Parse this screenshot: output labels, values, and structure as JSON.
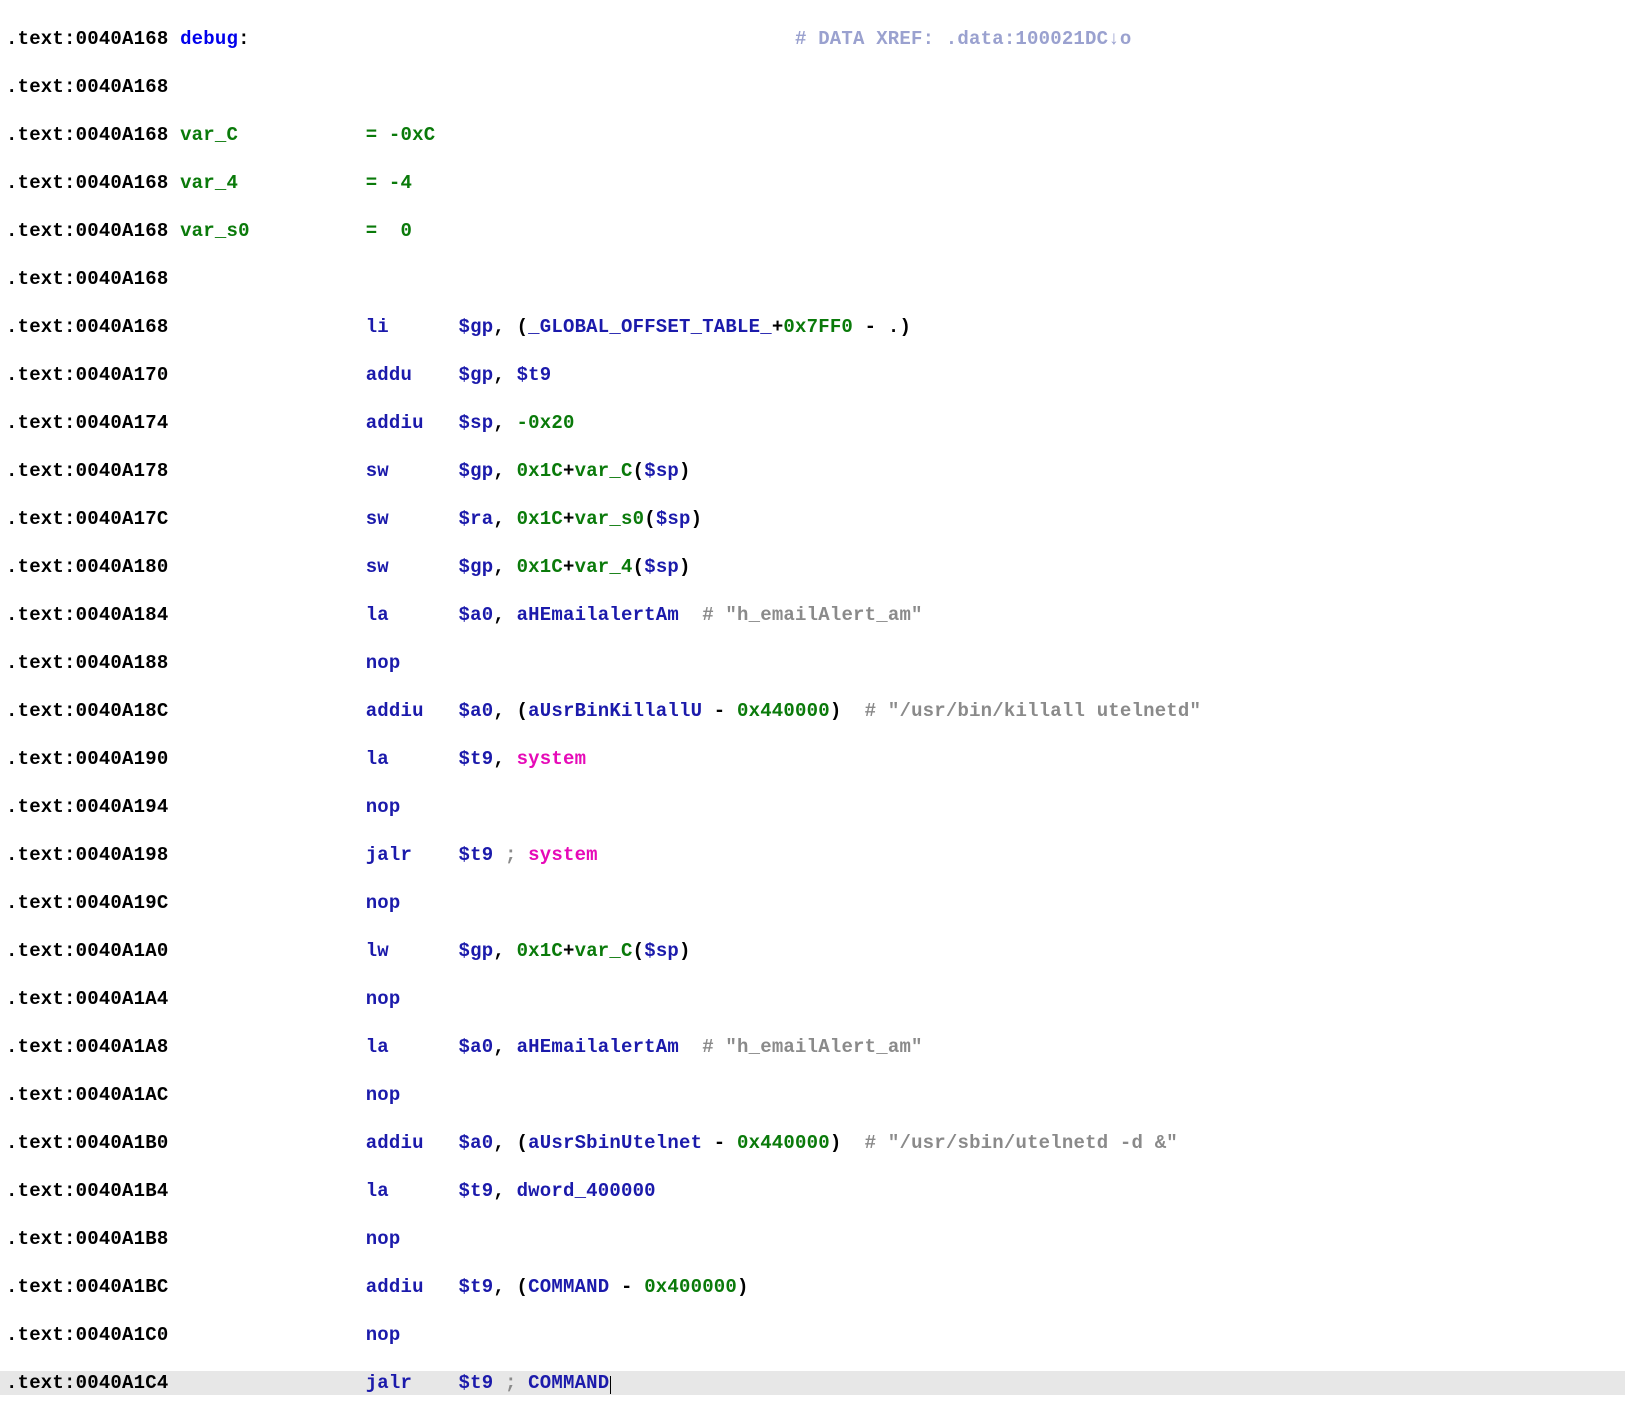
{
  "addr_prefix": ".text:",
  "addrs": {
    "a0": "0040A168",
    "a1": "0040A170",
    "a2": "0040A174",
    "a3": "0040A178",
    "a4": "0040A17C",
    "a5": "0040A180",
    "a6": "0040A184",
    "a7": "0040A188",
    "a8": "0040A18C",
    "a9": "0040A190",
    "a10": "0040A194",
    "a11": "0040A198",
    "a12": "0040A19C",
    "a13": "0040A1A0",
    "a14": "0040A1A4",
    "a15": "0040A1A8",
    "a16": "0040A1AC",
    "a17": "0040A1B0",
    "a18": "0040A1B4",
    "a19": "0040A1B8",
    "a20": "0040A1BC",
    "a21": "0040A1C0",
    "a22": "0040A1C4"
  },
  "label_debug": "debug",
  "colon": ":",
  "xref_comment": "# DATA XREF: .data:100021DC↓o",
  "vars": {
    "var_c_name": "var_C",
    "var_c_eq": "= -0xC",
    "var_4_name": "var_4",
    "var_4_eq": "= -4",
    "var_s0_name": "var_s0",
    "var_s0_eq": "=  0"
  },
  "mn": {
    "li": "li",
    "addu": "addu",
    "addiu": "addiu",
    "sw": "sw",
    "la": "la",
    "nop": "nop",
    "jalr": "jalr",
    "lw": "lw"
  },
  "reg": {
    "gp": "$gp",
    "t9": "$t9",
    "sp": "$sp",
    "ra": "$ra",
    "a0": "$a0"
  },
  "sym": {
    "got": "_GLOBAL_OFFSET_TABLE_",
    "aHEmailalertAm": "aHEmailalertAm",
    "aUsrBinKillallU": "aUsrBinKillallU",
    "aUsrSbinUtelnet": "aUsrSbinUtelnet",
    "dword_400000": "dword_400000",
    "COMMAND": "COMMAND",
    "system": "system"
  },
  "num": {
    "p7ff0": "0x7FF0",
    "m0x20": "-0x20",
    "x1c": "0x1C",
    "x440000": "0x440000",
    "x400000": "0x400000"
  },
  "cmt": {
    "h_email": "# \"h_emailAlert_am\"",
    "killall": "# \"/usr/bin/killall utelnetd\"",
    "utelnetd": "# \"/usr/sbin/utelnetd -d &\""
  },
  "punct": {
    "comma_sp": ", ",
    "lp": "(",
    "rp": ")",
    "plus": "+",
    "minus": " - ",
    "minus_dot": " - .)",
    "semi_sp": " ; "
  }
}
